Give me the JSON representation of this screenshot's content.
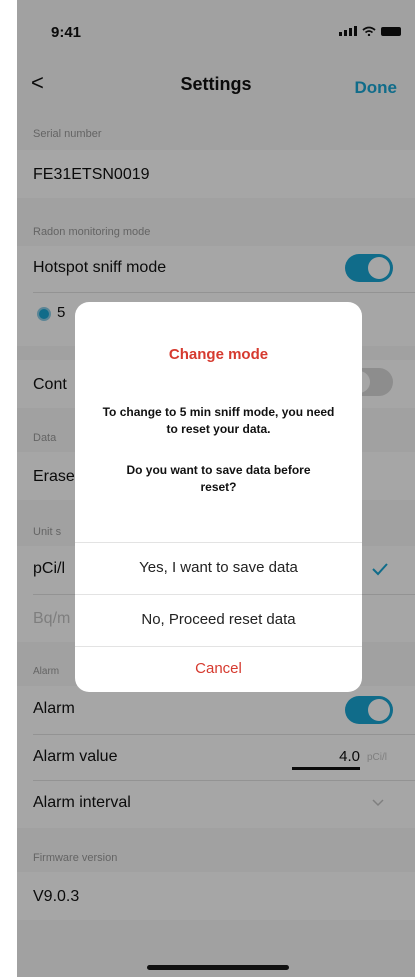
{
  "status_bar": {
    "time": "9:41"
  },
  "header": {
    "back_label": "<",
    "title": "Settings",
    "done_label": "Done"
  },
  "settings": {
    "serial": {
      "label": "Serial number",
      "value": "FE31ETSN0019"
    },
    "radon_mode": {
      "label": "Radon monitoring mode",
      "item": "Hotspot sniff mode",
      "option_partial": "5"
    },
    "continuous": {
      "partial": "Cont"
    },
    "data": {
      "label": "Data",
      "item_partial": "Erase"
    },
    "unit": {
      "label_partial": "Unit s",
      "option1_partial": "pCi/l",
      "option2_partial": "Bq/m"
    },
    "alarm": {
      "label_partial": "Alarm",
      "item": "Alarm",
      "value_label": "Alarm value",
      "value": "4.0",
      "unit": "pCi/l",
      "interval_label": "Alarm interval"
    },
    "firmware": {
      "label": "Firmware version",
      "value": "V9.0.3"
    }
  },
  "modal": {
    "title": "Change mode",
    "message1": "To change to 5 min sniff mode, you need to reset your data.",
    "message2": "Do you want to save data before reset?",
    "buttons": {
      "save": "Yes, I want to save data",
      "proceed": "No, Proceed reset data",
      "cancel": "Cancel"
    }
  },
  "colors": {
    "accent": "#1aa6d4",
    "danger": "#d63a2f"
  }
}
